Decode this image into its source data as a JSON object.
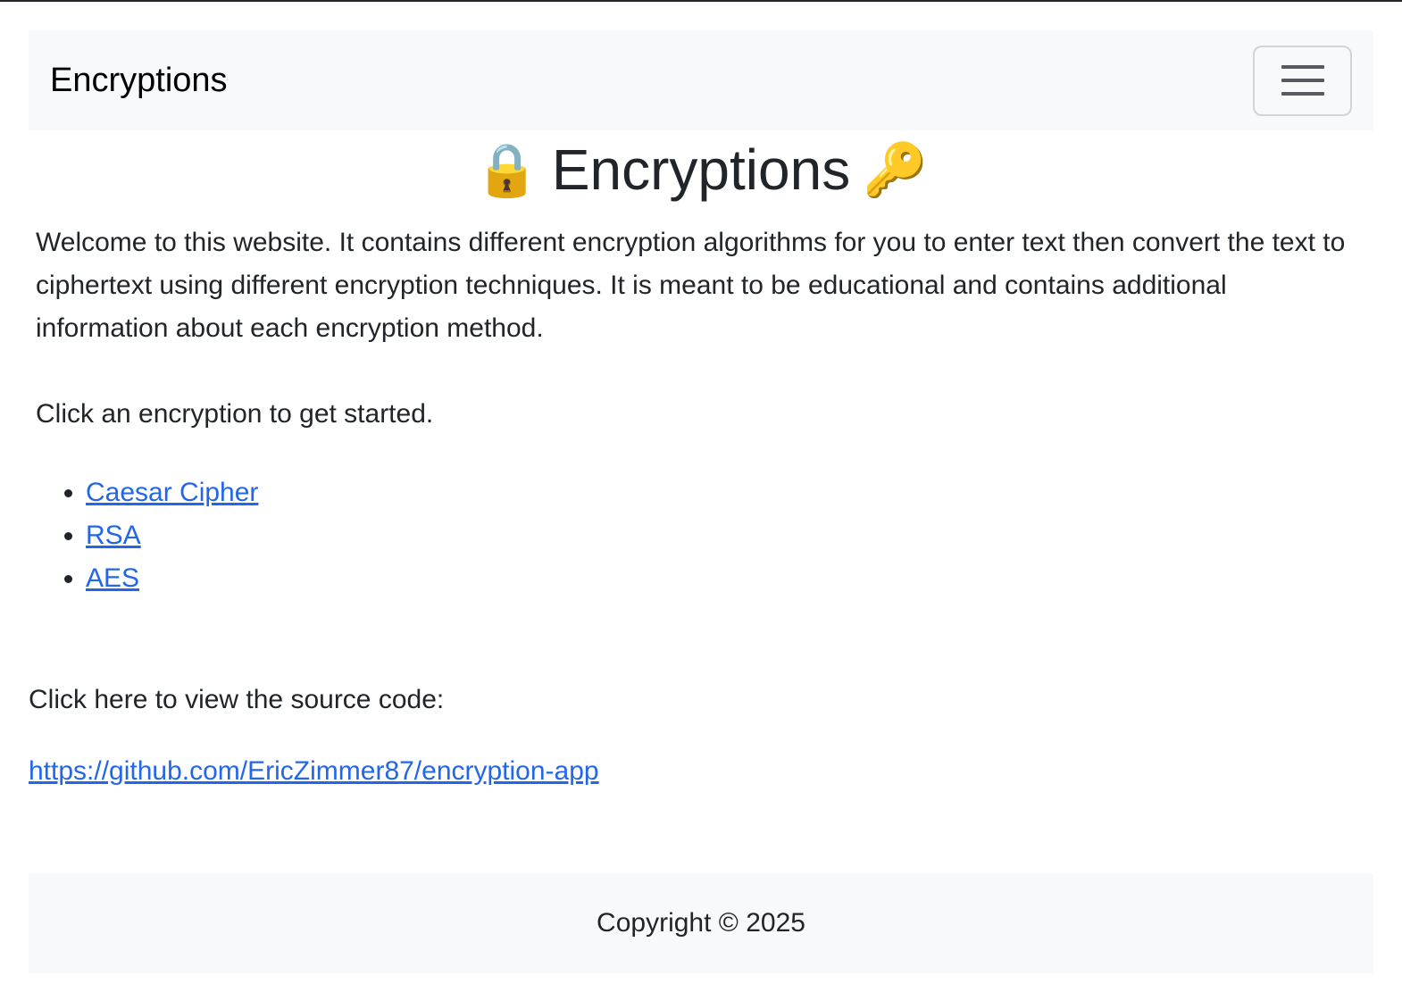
{
  "navbar": {
    "brand": "Encryptions",
    "toggler_icon": "hamburger-menu-icon"
  },
  "hero": {
    "title": "Encryptions",
    "left_icon": "🔒",
    "right_icon": "🔑"
  },
  "intro": {
    "text": "Welcome to this website. It contains different encryption algorithms for you to enter text then convert the text to ciphertext using different encryption techniques. It is meant to be educational and contains additional information about each encryption method.",
    "prompt": "Click an encryption to get started."
  },
  "encryptions": [
    {
      "label": "Caesar Cipher"
    },
    {
      "label": "RSA"
    },
    {
      "label": "AES"
    }
  ],
  "source": {
    "label": "Click here to view the source code:",
    "url": "https://github.com/EricZimmer87/encryption-app"
  },
  "footer": {
    "copyright": "Copyright © 2025"
  },
  "colors": {
    "link": "#2366e8",
    "navbar_bg": "#f8f9fa",
    "text": "#212529"
  }
}
